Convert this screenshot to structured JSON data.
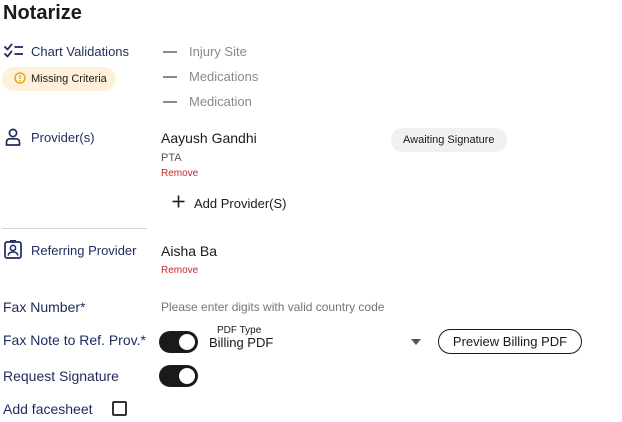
{
  "page": {
    "title": "Notarize"
  },
  "chart_validations": {
    "label": "Chart Validations",
    "icon": "checklist-icon",
    "badge": "Missing Criteria",
    "badge_icon": "warning-circle-icon",
    "criteria": [
      "Injury Site",
      "Medications",
      "Medication"
    ]
  },
  "providers": {
    "label": "Provider(s)",
    "icon": "person-icon",
    "items": [
      {
        "name": "Aayush Gandhi",
        "role": "PTA",
        "remove_label": "Remove",
        "status": "Awaiting Signature"
      }
    ],
    "add_label": "Add Provider(S)"
  },
  "referring_provider": {
    "label": "Referring Provider",
    "icon": "contact-badge-icon",
    "name": "Aisha Ba",
    "remove_label": "Remove"
  },
  "fax_number": {
    "label": "Fax Number*",
    "placeholder": "Please enter digits with valid country code",
    "value": ""
  },
  "fax_note": {
    "label": "Fax Note to Ref. Prov.*",
    "toggle_on": true,
    "pdf_type_label": "PDF Type",
    "pdf_type_value": "Billing PDF",
    "preview_button": "Preview Billing PDF"
  },
  "request_signature": {
    "label": "Request Signature",
    "toggle_on": true
  },
  "add_facesheet": {
    "label": "Add facesheet",
    "checked": false
  },
  "colors": {
    "accent": "#1f2a5c",
    "danger": "#c62828",
    "warning_bg": "#fff1d9",
    "toggle_on": "#1a1a1a"
  }
}
